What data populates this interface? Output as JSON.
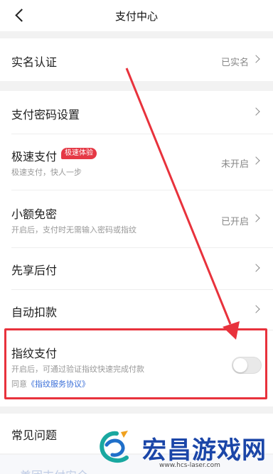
{
  "nav": {
    "title": "支付中心"
  },
  "rows": {
    "realname": {
      "label": "实名认证",
      "value": "已实名"
    },
    "paypwd": {
      "label": "支付密码设置"
    },
    "quickpay": {
      "label": "极速支付",
      "badge": "极速体验",
      "sub": "极速支付，快人一步",
      "value": "未开启"
    },
    "smallfree": {
      "label": "小额免密",
      "sub": "开启后，支付时无需输入密码或指纹",
      "value": "已开启"
    },
    "payafter": {
      "label": "先享后付"
    },
    "autodeduct": {
      "label": "自动扣款"
    },
    "fingerprint": {
      "label": "指纹支付",
      "sub": "开启后，可通过验证指纹快速完成付款",
      "agree_prefix": "同意",
      "agree_link": "《指纹服务协议》",
      "enabled": false
    },
    "faq": {
      "label": "常见问题"
    }
  },
  "watermark": {
    "text": "宏昌游戏网",
    "url": "www.hcs-laser.com",
    "faded": "美团支付安全"
  },
  "colors": {
    "highlight": "#e8323c",
    "badge": "#e53845",
    "link": "#3a6fd8",
    "watermark": "#1b46a8"
  }
}
